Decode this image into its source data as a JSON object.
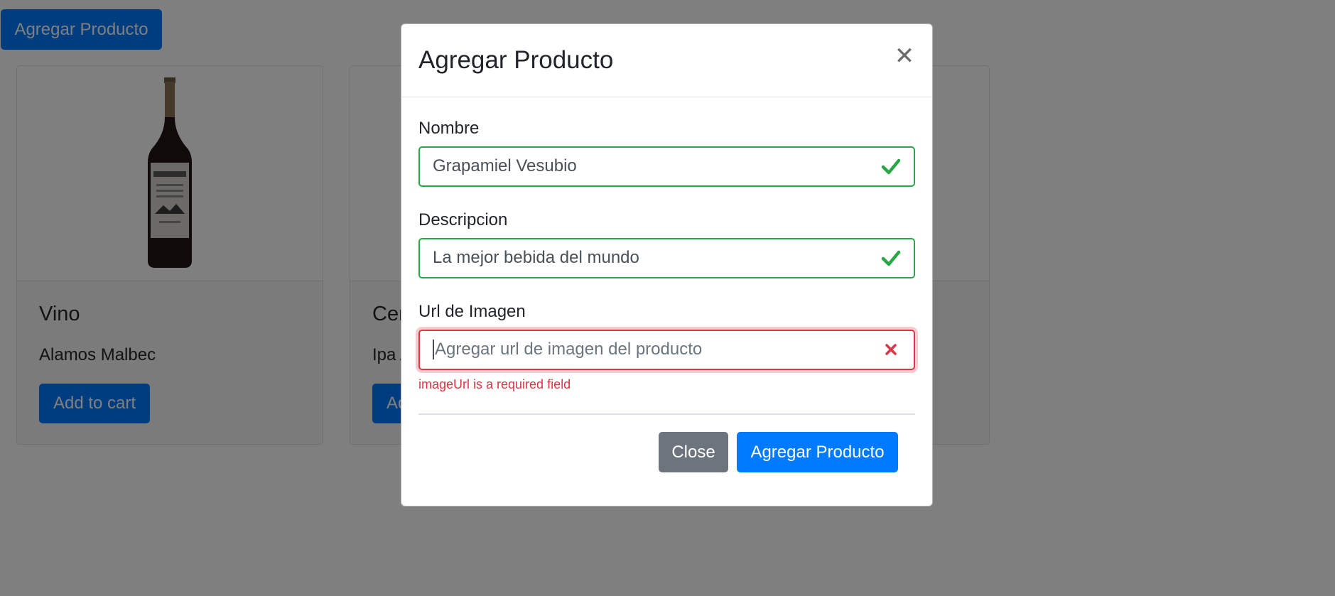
{
  "page": {
    "top_button_label": "Agregar Producto"
  },
  "products": [
    {
      "title": "Vino",
      "description": "Alamos Malbec",
      "button_label": "Add to cart",
      "image": "wine-bottle"
    },
    {
      "title": "Cer",
      "description": "Ipa A",
      "button_label": "Ad",
      "image": ""
    }
  ],
  "modal": {
    "title": "Agregar Producto",
    "close_icon": "close-icon",
    "fields": {
      "nombre": {
        "label": "Nombre",
        "value": "Grapamiel Vesubio",
        "state": "valid"
      },
      "descripcion": {
        "label": "Descripcion",
        "value": "La mejor bebida del mundo",
        "state": "valid"
      },
      "image_url": {
        "label": "Url de Imagen",
        "placeholder": "Agregar url de imagen del producto",
        "value": "",
        "state": "invalid",
        "error": "imageUrl is a required field"
      }
    },
    "footer": {
      "close_label": "Close",
      "submit_label": "Agregar Producto"
    }
  },
  "colors": {
    "primary": "#007bff",
    "secondary": "#6c757d",
    "valid": "#28a745",
    "invalid": "#dc3545"
  }
}
